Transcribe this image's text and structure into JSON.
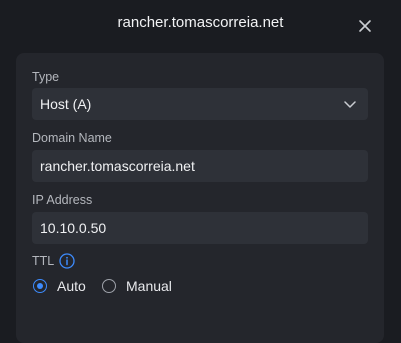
{
  "dialog": {
    "title": "rancher.tomascorreia.net"
  },
  "form": {
    "type": {
      "label": "Type",
      "value": "Host (A)"
    },
    "domain": {
      "label": "Domain Name",
      "value": "rancher.tomascorreia.net"
    },
    "ip": {
      "label": "IP Address",
      "value": "10.10.0.50"
    },
    "ttl": {
      "label": "TTL",
      "options": [
        "Auto",
        "Manual"
      ],
      "selected": "Auto"
    }
  },
  "icons": {
    "close": "close-icon",
    "dropdown": "chevron-down-icon",
    "info": "info-icon"
  },
  "colors": {
    "accent": "#3d8bfd",
    "background": "#1a1c21",
    "panel": "#24262c"
  }
}
